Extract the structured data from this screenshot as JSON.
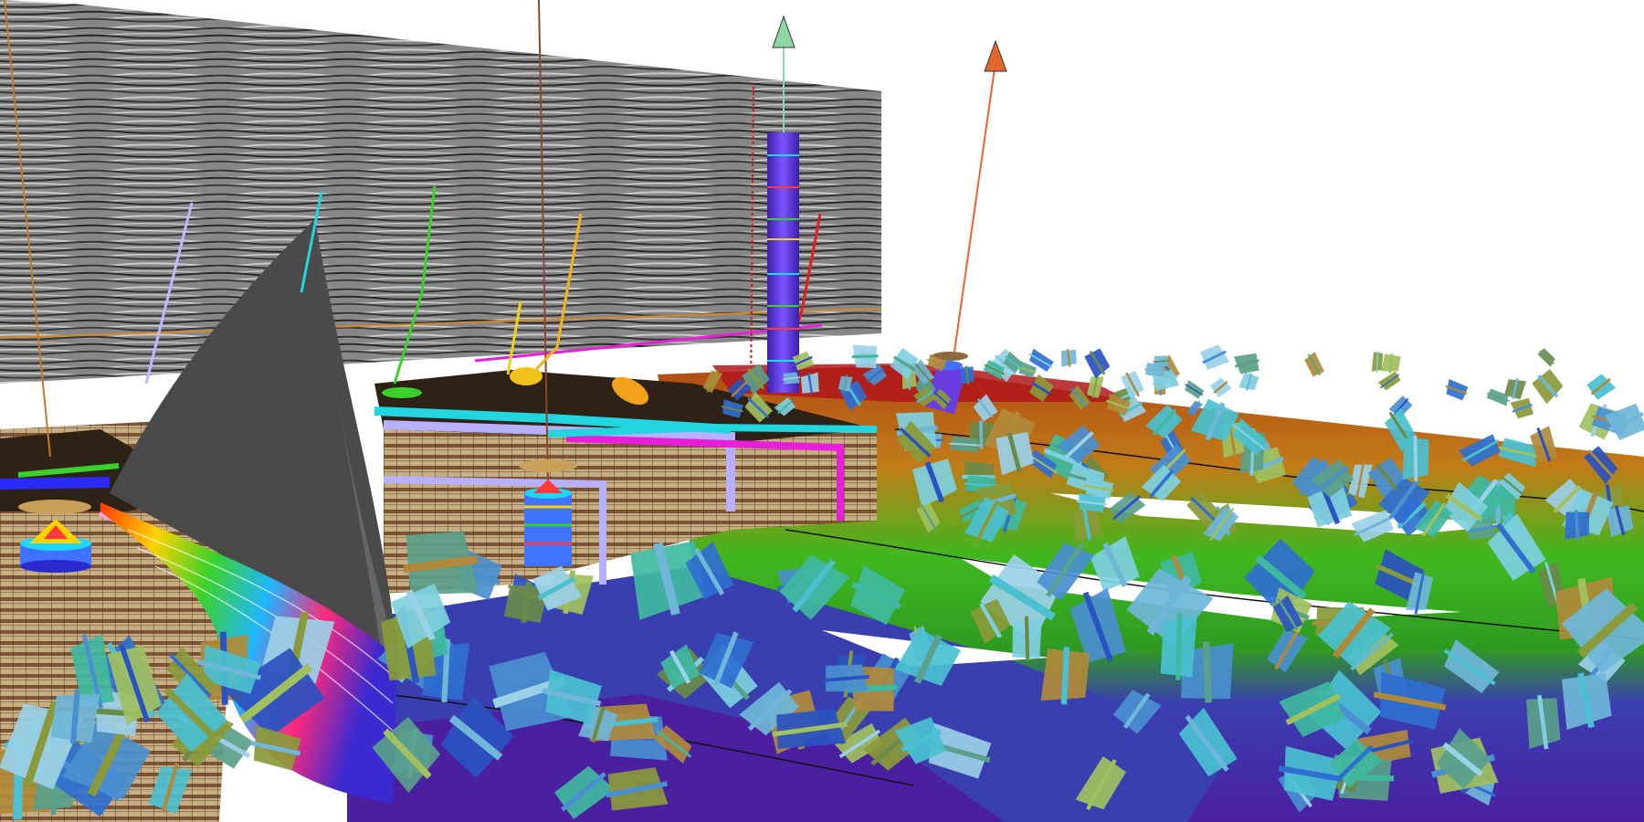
{
  "scene": {
    "kind": "3d-reservoir-visualization",
    "background": "#ffffff",
    "palette": {
      "seismic_light": "#d0d0d0",
      "seismic_dark": "#3a3a3a",
      "fault_surface": "#4a4a4a",
      "grid_tan": "#bfa57a",
      "grid_brown": "#6e4a2a",
      "horizon_green": "#3fb81f",
      "horizon_orange": "#c7741b",
      "horizon_blue": "#3a3fb0",
      "horizon_purple": "#5a2ea8",
      "well_stack_purple": "#6a3de0",
      "marker_green": "#8ed6a4",
      "marker_orange": "#e2662e",
      "lavender_band": "#b7b0ff",
      "cyan_band": "#22d6e0",
      "magenta_band": "#e81fd8"
    },
    "icons": [
      "well-marker-green-cone",
      "well-marker-orange-cone",
      "well-log-stack",
      "fracture-plane-glyph"
    ]
  }
}
